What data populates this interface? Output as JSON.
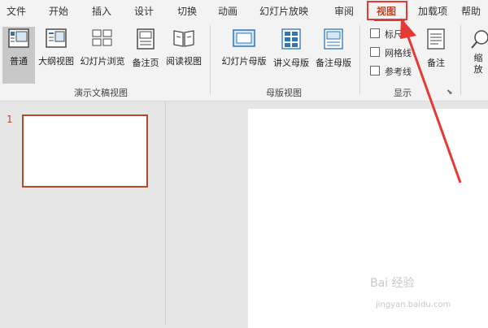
{
  "tabs": [
    "文件",
    "开始",
    "插入",
    "设计",
    "切换",
    "动画",
    "幻灯片放映",
    "审阅",
    "视图",
    "加载项",
    "帮助"
  ],
  "active_tab": "视图",
  "ribbon": {
    "presentation_views": {
      "normal": "普通",
      "outline": "大纲视图",
      "slide_sorter": "幻灯片浏览",
      "notes_page": "备注页",
      "reading_view": "阅读视图",
      "group_label": "演示文稿视图"
    },
    "master_views": {
      "slide_master": "幻灯片母版",
      "handout_master": "讲义母版",
      "notes_master": "备注母版",
      "group_label": "母版视图"
    },
    "show": {
      "ruler": "标尺",
      "gridlines": "网格线",
      "guides": "参考线",
      "notes": "备注",
      "group_label": "显示"
    },
    "zoom_partial": "缩放"
  },
  "slide_panel": {
    "slide_number": "1"
  },
  "watermark": {
    "text": "Bai 经验",
    "url": "jingyan.baidu.com"
  },
  "colors": {
    "accent": "#b7472a",
    "annotation": "#e53935"
  }
}
